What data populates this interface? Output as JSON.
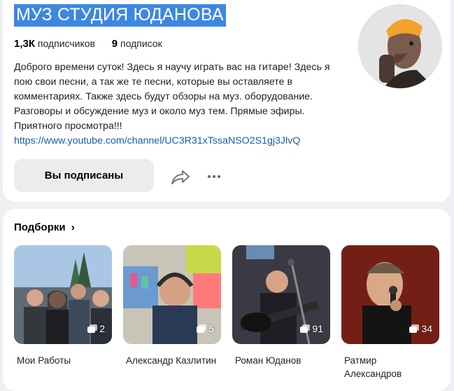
{
  "channel": {
    "title": "МУЗ СТУДИЯ ЮДАНОВА",
    "subscribers_count": "1,3К",
    "subscribers_label": "подписчиков",
    "subscriptions_count": "9",
    "subscriptions_label": "подписок",
    "description": "Доброго времени суток! Здесь я научу играть вас на гитаре! Здесь я пою свои песни, а так же те песни, которые вы оставляете в комментариях. Также здесь будут обзоры на муз. оборудование. Разговоры и обсуждение муз и около муз тем. Прямые эфиры. Приятного просмотра!!!",
    "link": "https://www.youtube.com/channel/UC3R31xTssaNSO2S1gj3JlvQ",
    "subscribe_label": "Вы подписаны",
    "more_glyph": "···"
  },
  "collections": {
    "title": "Подборки",
    "chevron": "›",
    "items": [
      {
        "label": "Мои Работы",
        "count": "2"
      },
      {
        "label": "Александр Казлитин",
        "count": "5"
      },
      {
        "label": "Роман Юданов",
        "count": "91"
      },
      {
        "label": "Ратмир Александров",
        "count": "34"
      }
    ]
  },
  "colors": {
    "title_highlight": "#3d87e0",
    "link": "#1a5ba8",
    "page_bg": "#eef0f3",
    "button_bg": "#ececec"
  }
}
